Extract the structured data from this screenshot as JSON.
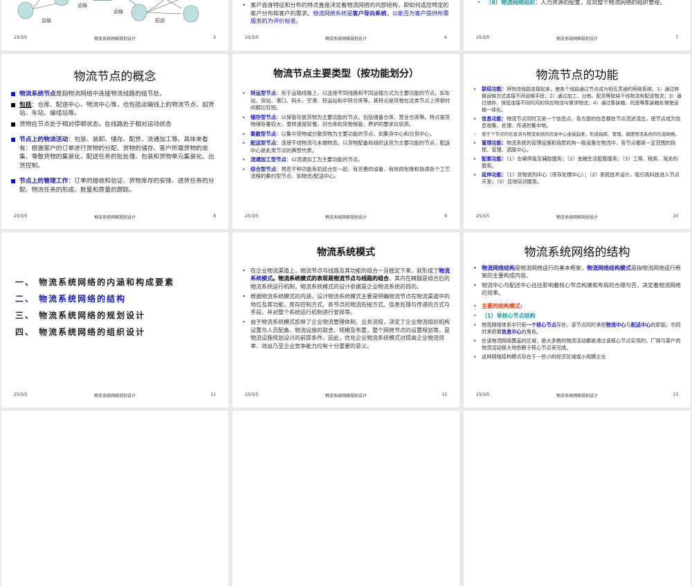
{
  "footer": {
    "date": "25/3/5",
    "title": "物流系统网络规划设计"
  },
  "slides": [
    {
      "number": "5",
      "labels": [
        "运输",
        "运输",
        "运输",
        "配送"
      ]
    },
    {
      "number": "6",
      "bullet": {
        "text": "客户自身特征和分布的特点直接决定着物流网络的内部结构，即如何适应特定的客户分布和客户的需求。",
        "blue": "物流网络系统是",
        "bold": "客户导向系统",
        "tail": "，以能否为客户提供所需服务的为评价标准。"
      }
    },
    {
      "number": "7",
      "bullet": {
        "teal": "（6）物流网络组织",
        "text": "：人力资源的配置，及对整个物流网络的组织管理。"
      }
    },
    {
      "number": "8",
      "title": "物流节点的概念",
      "items": [
        {
          "kw": "物流系统节点",
          "text": "是指物流网络中连接物流线路的结节处。"
        },
        {
          "kw": "包括",
          "text": "：仓库、配送中心、物流中心等，也包括运输线上的物流节点，如货站、车站、编组站等。"
        },
        {
          "kw": "",
          "text": "货物在节点处于相对停顿状态，在线路处于相对运动状态"
        },
        {
          "kw": "节点上的物流活动",
          "text": "：包装、装卸、储存、配货、流通加工等。具体来看有：根据客户的订单进行货物的分配、货物的储存、客户所需货物的收集、零散货物的集装化、配送任务的批处理、包装和货物单元集装化、出货控制。"
        },
        {
          "kw": "节点上的管理工作",
          "text": "：订单的接收和验证、货物库存的安排、送货任务的分配、物流任务的形成、数量和质量的跟踪。"
        }
      ]
    },
    {
      "number": "9",
      "title": "物流节点主要类型（按功能划分）",
      "items": [
        {
          "kw": "转运型节点",
          "text": "：处于运输线路上，以连接不同线路和不同运输方式为主要功能的节点，如车站、货站、港口、码头、空港、转运站和中转仓库等。其特点是货物在这类节点上停顿时间都比较短。"
        },
        {
          "kw": "储存型节点",
          "text": "：以保管存放货物为主要功能的节点，包括储备仓库、营业仓库等。特点是货物储存量较大，周转速度较慢，对仓库的货物保管、养护的要求比较高。"
        },
        {
          "kw": "集散型节点",
          "text": "：以集中货物或分散货物为主要功能的节点，如集货中心和分货中心。"
        },
        {
          "kw": "配送型节点",
          "text": "：连接干线物流与末端物流，以货物配备和组织送货为主要功能的节点，配送中心是此类节点的典型代表。"
        },
        {
          "kw": "流通加工型节点",
          "text": "：以流通加工为主要功能的节点。"
        },
        {
          "kw": "综合型节点",
          "text": "：将若干种功能有机结合在一起，有完善的设备、有效的衔接和协调各个工艺流程的集约型节点，如物流/配送中心。"
        }
      ]
    },
    {
      "number": "10",
      "title": "物流节点的功能",
      "items": [
        {
          "kw": "联结功能：",
          "text": "将物流线路连接起来，使各个线路通过节点成为相互贯通的网络系统。1）通过转换运输方式连接不同运输手段；2）通过加工、分拣、配货等联结干线物流和配送物流；3）通过储存、保管连接不同时间的供应物流与需求物流；4）通过集装箱、托盘等集装箱处理使运输一体化。"
        },
        {
          "kw": "信息功能：",
          "text": "物流节点同时又是一个信息点，各方面的信息都在节点流进流出，使节点成为信息收集、处理、传递的集中地。"
        },
        {
          "kw": "",
          "text": "若干个节点的信息流与物流系统的信息中心连接起来，形成指挥、管理、调度物流系统的信息网络。",
          "sub": true
        },
        {
          "kw": "管理功能：",
          "text": "物流系统的管理设施和指挥机构一般设置在物流中，各节点都是一定范围的指挥、管理、调度中心。"
        },
        {
          "kw": "配套功能：",
          "text": "（1）车辆停靠及辅助服务；（2）金融生活配套服务；（3）工商、税务、海关的服务。"
        },
        {
          "kw": "延伸功能：",
          "text": "（1）货物调剂中心（库存处理中心）；（2）系统技术设计，吸引高科技进入节点开发；（3）咨询培训服务。"
        }
      ]
    },
    {
      "number": "11",
      "toc": [
        "一、 物流系统网络的内涵和构成要素",
        "二、 物流系统网络的结构",
        "三、 物流系统网络的规划设计",
        "四、 物流系统网络的组织设计"
      ]
    },
    {
      "number": "12",
      "title": "物流系统模式",
      "items": [
        {
          "a": "在企业物流渠道上，物流节点与线路及其功能的组合一旦稳定下来，就形成了",
          "kw": "物流系统模式",
          "bold": "。物流系统模式的表现是物流节点与线路的组合",
          "text": "，其内在精髓是组合后的物流系统运行机制，物流系统模式的设计依据是企业物流系统的目的。"
        },
        {
          "text": "根据物流系统模式的内涵，设计物流系统模式主要是明确物流节点在物流渠道中的地位及其功能，库存控制方式、各节点的物流衔接方式、信息处理与传递的方式与手段，并对整个系统运行机制进行安排等。"
        },
        {
          "text": "由于物流系统模式反映了企业物流管理体制、业务流程，决定了企业物流组织机构设置与人员配备、物流设施的取舍、规模及布置，整个网络节点的设置规划等，是物流设施规划设计的前提条件。因此，优化企业物流系统模式对提高企业物流效率、效益乃至企业竞争能力均有十分重要的意义。"
        }
      ]
    },
    {
      "number": "13",
      "title": "物流系统网络的结构",
      "b1": {
        "kw": "物流网络结构",
        "a": "是物流网络运行的基本框架，",
        "kw2": "物流网络结构模式",
        "b": "是指物流网络运行框架的主要构成内容。"
      },
      "b2": "物流中心与配送中心往往影响着核心节点构建和布局的合理与否，决定着物流网络的效率。",
      "b3": "主要的结构模式:",
      "b4": "（1）单核心节点结构",
      "b5": {
        "a": "物流网络体系中只有",
        "k1": "一个核心节点",
        "b": "存在，该节点同时承担",
        "k2": "物流中心",
        "c": "与",
        "k3": "配送中心",
        "d": "的职能，也同时承担着",
        "k4": "信息中心",
        "e": "的角色。"
      },
      "b6": "在该物流网络覆盖的区域，绝大多数的物流活动都是通过该核心节点实现的，厂商与客户的物流活动极大地依赖于核心节点来完成。",
      "b7": "这种网络结构模式存在于一些小的经济区域或小规模企业"
    }
  ]
}
